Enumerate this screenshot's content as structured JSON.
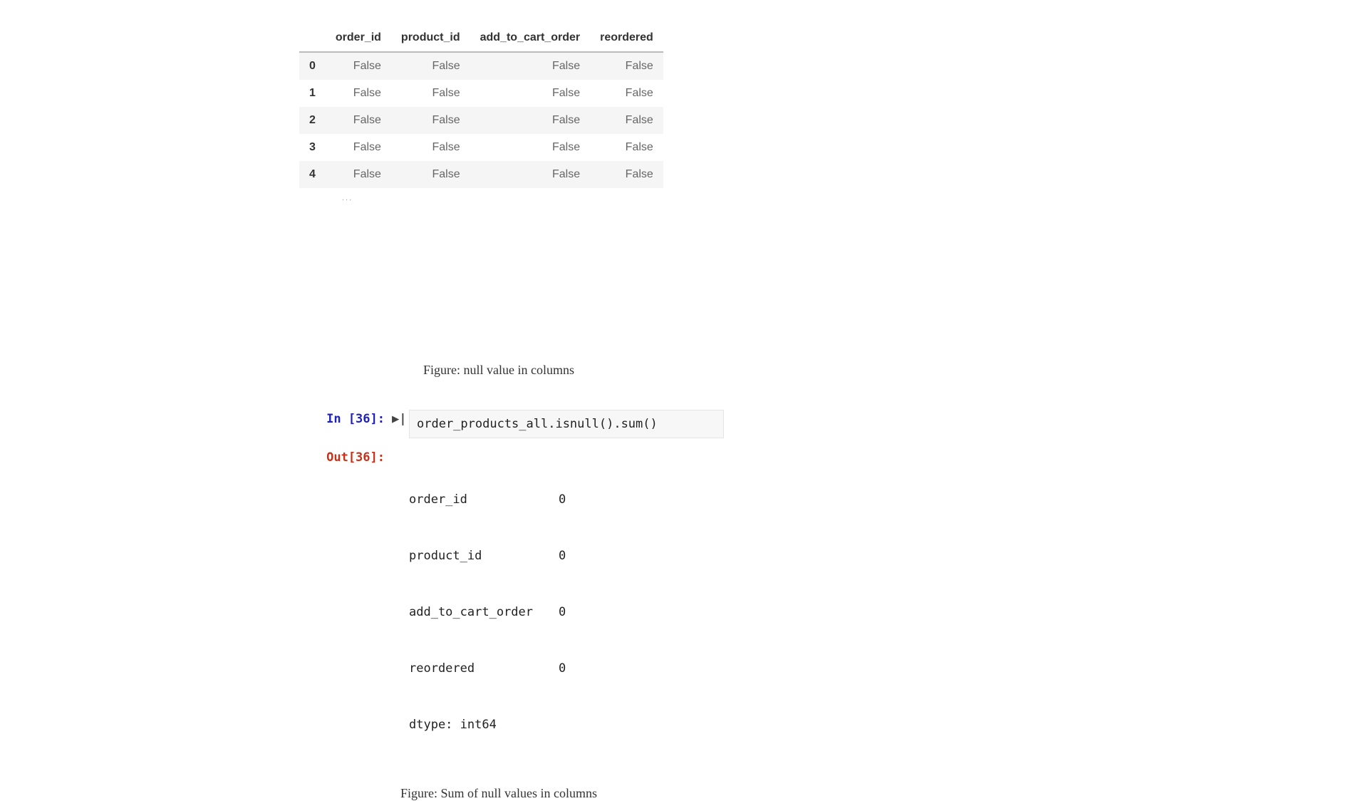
{
  "table": {
    "columns": [
      "order_id",
      "product_id",
      "add_to_cart_order",
      "reordered"
    ],
    "rows": [
      {
        "index": "0",
        "cells": [
          "False",
          "False",
          "False",
          "False"
        ]
      },
      {
        "index": "1",
        "cells": [
          "False",
          "False",
          "False",
          "False"
        ]
      },
      {
        "index": "2",
        "cells": [
          "False",
          "False",
          "False",
          "False"
        ]
      },
      {
        "index": "3",
        "cells": [
          "False",
          "False",
          "False",
          "False"
        ]
      },
      {
        "index": "4",
        "cells": [
          "False",
          "False",
          "False",
          "False"
        ]
      }
    ],
    "ellipsis": "..."
  },
  "captions": {
    "fig1": "Figure: null value in columns",
    "fig2": "Figure: Sum of null values in columns"
  },
  "cell": {
    "in_prompt": "In [36]:",
    "out_prompt": "Out[36]:",
    "run_glyph": "▶|",
    "code": "order_products_all.isnull().sum()",
    "output_lines": [
      {
        "key": "order_id",
        "val": "0"
      },
      {
        "key": "product_id",
        "val": "0"
      },
      {
        "key": "add_to_cart_order",
        "val": "0"
      },
      {
        "key": "reordered",
        "val": "0"
      }
    ],
    "dtype_line": "dtype: int64"
  }
}
